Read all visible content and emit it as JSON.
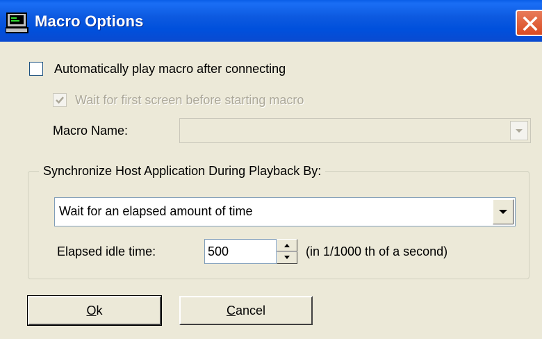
{
  "window": {
    "title": "Macro Options",
    "icon": "terminal-icon",
    "close_icon": "close-icon"
  },
  "auto_play": {
    "label": "Automatically play macro after connecting",
    "checked": false
  },
  "wait_first_screen": {
    "label": "Wait for first screen before starting macro",
    "checked": true,
    "enabled": false
  },
  "macro_name": {
    "label": "Macro Name:",
    "value": "",
    "enabled": false
  },
  "sync_group": {
    "label": "Synchronize Host Application During Playback By:",
    "selected": "Wait for an elapsed amount of time"
  },
  "idle_time": {
    "label": "Elapsed idle time:",
    "value": "500",
    "unit": "(in 1/1000 th of a second)"
  },
  "buttons": {
    "ok_mnemonic": "O",
    "ok_rest": "k",
    "cancel_mnemonic": "C",
    "cancel_rest": "ancel"
  },
  "colors": {
    "titlebar": "#0054e3",
    "dialog_bg": "#ece9d8",
    "close": "#d94b22"
  }
}
